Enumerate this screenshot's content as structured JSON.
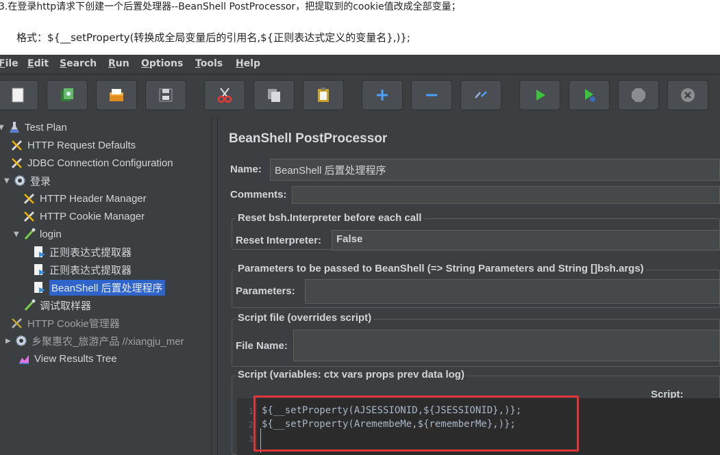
{
  "doc": {
    "step_text": "3.在登录http请求下创建一个后置处理器--BeanShell PostProcessor，把提取到的cookie值改成全部变量；",
    "format_text": "格式：${__setProperty(转换成全局变量后的引用名,${正则表达式定义的变量名},)};"
  },
  "menu": [
    "File",
    "Edit",
    "Search",
    "Run",
    "Options",
    "Tools",
    "Help"
  ],
  "toolbar": {
    "buttons": [
      "new-icon",
      "templates-icon",
      "open-icon",
      "save-icon",
      "cut-icon",
      "copy-icon",
      "paste-icon",
      "expand-icon",
      "collapse-icon",
      "toggle-icon",
      "start-icon",
      "start-no-pauses-icon",
      "stop-icon",
      "shutdown-icon"
    ]
  },
  "tree": {
    "items": [
      {
        "label": "Test Plan",
        "icon": "flask-icon",
        "expander": "▼"
      },
      {
        "label": "HTTP Request Defaults",
        "icon": "wrench-icon"
      },
      {
        "label": "JDBC Connection Configuration",
        "icon": "wrench-icon"
      },
      {
        "label": "登录",
        "icon": "gear-icon",
        "expander": "▼"
      },
      {
        "label": "HTTP Header Manager",
        "icon": "wrench-icon"
      },
      {
        "label": "HTTP Cookie Manager",
        "icon": "wrench-icon"
      },
      {
        "label": "login",
        "icon": "pipette-icon",
        "expander": "▼"
      },
      {
        "label": "正则表达式提取器",
        "icon": "post-processor-icon"
      },
      {
        "label": "正则表达式提取器",
        "icon": "post-processor-icon"
      },
      {
        "label": "BeanShell 后置处理程序",
        "icon": "post-processor-icon",
        "selected": true
      },
      {
        "label": "调试取样器",
        "icon": "pipette-icon"
      },
      {
        "label": "HTTP Cookie管理器",
        "icon": "wrench-icon",
        "disabled": true
      },
      {
        "label": "乡聚惠农_旅游产品 //xiangju_mer",
        "icon": "gear-icon",
        "expander": "▶",
        "disabled": true
      },
      {
        "label": "View Results Tree",
        "icon": "chart-icon"
      }
    ]
  },
  "panel": {
    "title": "BeanShell PostProcessor",
    "name_label": "Name:",
    "name_value": "BeanShell 后置处理程序",
    "comments_label": "Comments:",
    "comments_value": "",
    "reset_group": "Reset bsh.Interpreter before each call",
    "reset_label": "Reset Interpreter:",
    "reset_value": "False",
    "params_group": "Parameters to be passed to BeanShell (=> String Parameters and String []bsh.args)",
    "params_label": "Parameters:",
    "params_value": "",
    "file_group": "Script file (overrides script)",
    "file_label": "File Name:",
    "file_value": "",
    "script_group": "Script (variables: ctx vars props prev data log)",
    "script_label": "Script:"
  },
  "script": {
    "line_numbers": [
      "1",
      "2",
      "3"
    ],
    "lines": [
      "${__setProperty(AJSESSIONID,${JSESSIONID},)};",
      "${__setProperty(AremembeMe,${rememberMe},)};",
      ""
    ]
  },
  "colors": {
    "highlight_box": "#e0343a",
    "selection": "#2f65ca",
    "background": "#3c3f41"
  }
}
